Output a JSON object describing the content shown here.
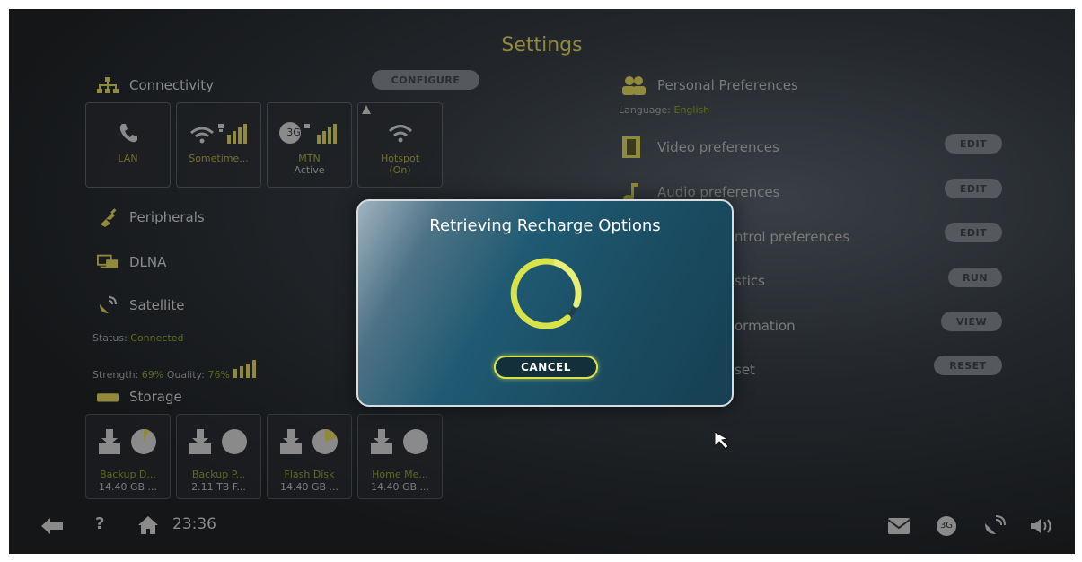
{
  "header": {
    "title": "Settings"
  },
  "connectivity": {
    "label": "Connectivity",
    "configure_label": "CONFIGURE",
    "tiles": [
      {
        "name": "LAN",
        "sub": ""
      },
      {
        "name": "Sometime...",
        "sub": ""
      },
      {
        "name": "MTN",
        "sub": "Active"
      },
      {
        "name": "Hotspot",
        "sub": "(On)"
      }
    ],
    "badge_3g": "3G"
  },
  "peripherals": {
    "label": "Peripherals"
  },
  "dlna": {
    "label": "DLNA"
  },
  "satellite": {
    "label": "Satellite",
    "status_label": "Status:",
    "status_value": "Connected",
    "strength_label": "Strength:",
    "strength_value": "69%",
    "quality_label": "Quality:",
    "quality_value": "76%"
  },
  "storage": {
    "label": "Storage",
    "tiles": [
      {
        "name": "Backup D...",
        "size": "14.40 GB ..."
      },
      {
        "name": "Backup P...",
        "size": "2.11 TB F..."
      },
      {
        "name": "Flash Disk",
        "size": "14.40 GB ..."
      },
      {
        "name": "Home Me...",
        "size": "14.40 GB ..."
      }
    ]
  },
  "personal": {
    "label": "Personal Preferences",
    "language_label": "Language:",
    "language_value": "English",
    "rows": [
      {
        "label": "Video preferences",
        "action": "EDIT",
        "icon": "film-icon"
      },
      {
        "label": "Audio preferences",
        "action": "EDIT",
        "icon": "music-note-icon"
      },
      {
        "label": "ntrol preferences",
        "action": "EDIT",
        "icon": ""
      },
      {
        "label": "stics",
        "action": "RUN",
        "icon": ""
      },
      {
        "label": "ormation",
        "action": "VIEW",
        "icon": ""
      },
      {
        "label": "set",
        "action": "RESET",
        "icon": ""
      }
    ]
  },
  "footer": {
    "time": "23:36",
    "help": "?",
    "badge_3g": "3G"
  },
  "dialog": {
    "title": "Retrieving Recharge Options",
    "cancel_label": "CANCEL"
  },
  "colors": {
    "accent_yellow": "#d8e34a",
    "dialog_teal": "#1f5a72",
    "dim_text": "#8a8a8a"
  }
}
